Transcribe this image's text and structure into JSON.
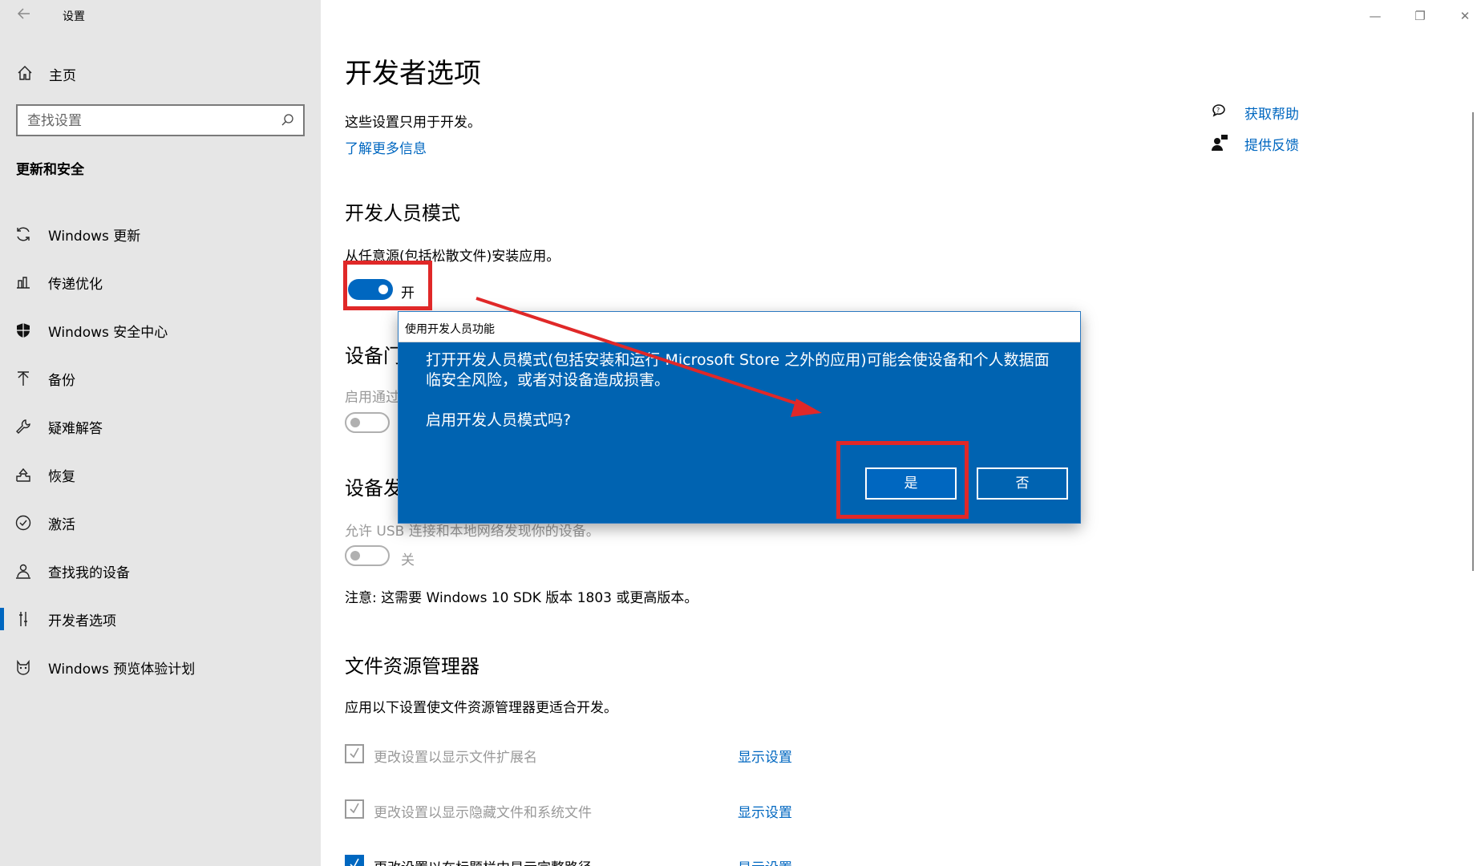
{
  "window": {
    "app_title": "设置",
    "back_icon": "back-arrow-icon",
    "controls": {
      "minimize": "—",
      "maximize": "❐",
      "close": "✕"
    }
  },
  "sidebar": {
    "home_label": "主页",
    "search_placeholder": "查找设置",
    "section_title": "更新和安全",
    "items": [
      {
        "label": "Windows 更新",
        "icon": "sync-icon"
      },
      {
        "label": "传递优化",
        "icon": "delivery-optimization-icon"
      },
      {
        "label": "Windows 安全中心",
        "icon": "shield-icon"
      },
      {
        "label": "备份",
        "icon": "backup-arrow-icon"
      },
      {
        "label": "疑难解答",
        "icon": "wrench-icon"
      },
      {
        "label": "恢复",
        "icon": "recovery-icon"
      },
      {
        "label": "激活",
        "icon": "check-circle-icon"
      },
      {
        "label": "查找我的设备",
        "icon": "person-locate-icon"
      },
      {
        "label": "开发者选项",
        "icon": "developer-tools-icon",
        "active": true
      },
      {
        "label": "Windows 预览体验计划",
        "icon": "insider-cat-icon"
      }
    ]
  },
  "main": {
    "title": "开发者选项",
    "description": "这些设置只用于开发。",
    "learn_more": "了解更多信息",
    "help": {
      "get_help": "获取帮助",
      "feedback": "提供反馈"
    },
    "dev_mode": {
      "heading": "开发人员模式",
      "desc": "从任意源(包括松散文件)安装应用。",
      "toggle_state": "开"
    },
    "device_portal": {
      "heading_visible": "设备门",
      "desc_visible": "启用通过"
    },
    "device_discovery": {
      "heading_visible": "设备发",
      "desc": "允许 USB 连接和本地网络发现你的设备。",
      "toggle_state": "关",
      "note": "注意: 这需要 Windows 10 SDK 版本 1803 或更高版本。"
    },
    "file_explorer": {
      "heading": "文件资源管理器",
      "desc": "应用以下设置使文件资源管理器更适合开发。",
      "options": [
        {
          "label": "更改设置以显示文件扩展名",
          "link": "显示设置",
          "checked": true
        },
        {
          "label": "更改设置以显示隐藏文件和系统文件",
          "link": "显示设置",
          "checked": true
        },
        {
          "label": "更改设置以在标题栏中显示完整路径",
          "link": "显示设置",
          "checked": true
        }
      ]
    }
  },
  "dialog": {
    "title": "使用开发人员功能",
    "message": "打开开发人员模式(包括安装和运行 Microsoft Store 之外的应用)可能会使设备和个人数据面临安全风险，或者对设备造成损害。",
    "question": "启用开发人员模式吗?",
    "yes": "是",
    "no": "否"
  },
  "colors": {
    "accent": "#0067c0",
    "dialog_bg": "#0063b1",
    "sidebar_bg": "#e6e6e6",
    "annotation": "#e02828"
  }
}
